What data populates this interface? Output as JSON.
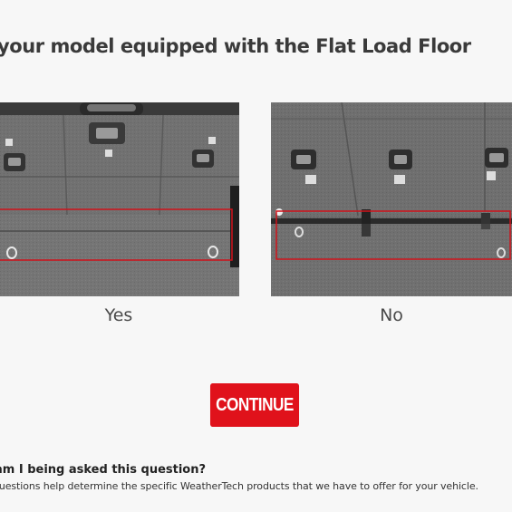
{
  "question": {
    "title": "your model equipped with the Flat Load Floor"
  },
  "options": [
    {
      "label": "Yes"
    },
    {
      "label": "No"
    }
  ],
  "continue_label": "CONTINUE",
  "why": {
    "title": "am I being asked this question?",
    "text": "questions help determine the specific WeatherTech products that we have to offer for your vehicle."
  },
  "colors": {
    "accent": "#e0121b",
    "highlight_box": "#d0121b",
    "page_background": "#f7f7f7"
  }
}
